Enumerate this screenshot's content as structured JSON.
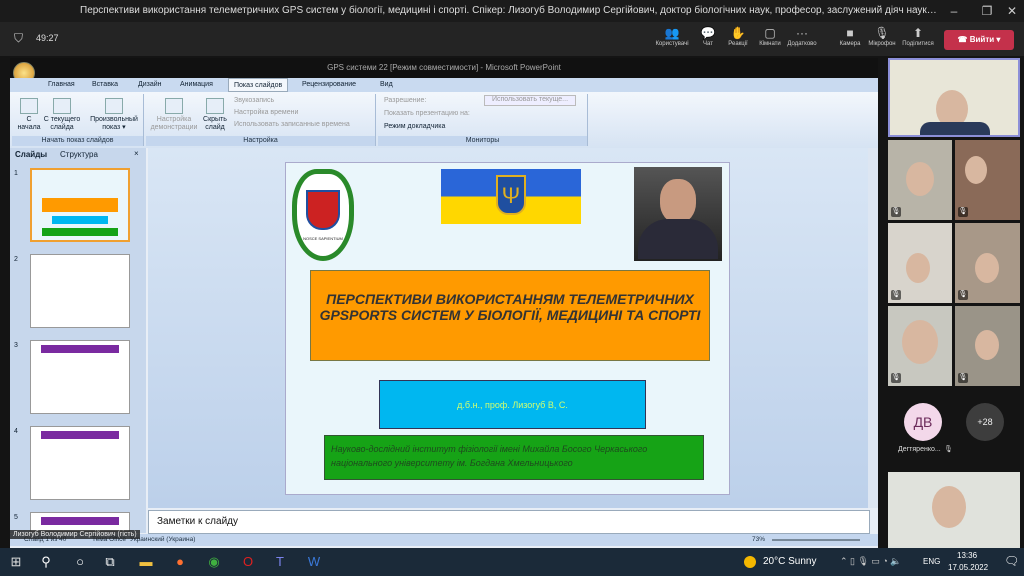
{
  "window": {
    "title": "Перспективи використання телеметричних GPS систем у біології, медицині і спорті. Спікер: Лизогуб Володимир Сергійович, доктор біологічних наук, професор, заслужений діяч науки і техніки, директор інституту біології ім. М. Босого ЧНУ ...",
    "minimize": "–",
    "maximize": "❐",
    "close": "✕"
  },
  "meeting": {
    "timer": "49:27",
    "toolbar": [
      {
        "label": "Користувачі",
        "icon": "people-icon",
        "glyph": "👥"
      },
      {
        "label": "Чат",
        "icon": "chat-icon",
        "glyph": "💬"
      },
      {
        "label": "Реакції",
        "icon": "reactions-icon",
        "glyph": "✋"
      },
      {
        "label": "Кімнати",
        "icon": "rooms-icon",
        "glyph": "▢"
      },
      {
        "label": "Додатково",
        "icon": "more-icon",
        "glyph": "···"
      },
      {
        "label": "Камера",
        "icon": "camera-icon",
        "glyph": "■"
      },
      {
        "label": "Мікрофон",
        "icon": "mic-off-icon",
        "glyph": "🎙"
      },
      {
        "label": "Поділитися",
        "icon": "share-icon",
        "glyph": "⬆"
      }
    ],
    "leave": "Вийти"
  },
  "ppt": {
    "title": "GPS системи 22 [Режим совместимости] - Microsoft PowerPoint",
    "tabs": [
      "Главная",
      "Вставка",
      "Дизайн",
      "Анимация",
      "Показ слайдов",
      "Рецензирование",
      "Вид"
    ],
    "ribbon": {
      "start_group": "Начать показ слайдов",
      "from_start": "С начала",
      "from_current": "С текущего слайда",
      "custom": "Произвольный показ ▾",
      "setup_group": "Настройка",
      "setup_show": "Настройка демонстрации",
      "hide_slide": "Скрыть слайд",
      "record": "Звукозапись",
      "timing": "Настройка времени",
      "use_timings": "Использовать записанные времена",
      "monitors_group": "Мониторы",
      "resolution": "Разрешение:",
      "resolution_value": "Использовать текуще...",
      "show_on": "Показать презентацию на:",
      "presenter": "Режим докладчика"
    },
    "panel_tabs": [
      "Слайды",
      "Структура"
    ],
    "slide_numbers": [
      "1",
      "2",
      "3",
      "4",
      "5"
    ],
    "slide": {
      "motto": "NOSCE SAPIENTIUM",
      "title": "ПЕРСПЕКТИВИ ВИКОРИСТАННЯМ ТЕЛЕМЕТРИЧНИХ GPSPORTS СИСТЕМ У БІОЛОГІЇ, МЕДИЦИНІ ТА СПОРТІ",
      "author": "д.б.н., проф. Лизогуб В, С.",
      "institute": "Науково-дослідний інститут фізіології імені Михайла Босого Черкаського національного університету ім. Богдана Хмельницького"
    },
    "notes": "Заметки к слайду",
    "status": {
      "slide": "Слайд 1 из 40",
      "theme": "Тема Office",
      "lang": "Украинский (Украина)",
      "zoom": "73%"
    },
    "presenter_tag": "Лизогуб Володимир Сергійович (гість)"
  },
  "participants": {
    "avatar_initials": "ДВ",
    "avatar_name": "Дегтяренко...",
    "more": "+28"
  },
  "taskbar": {
    "weather": "20°C  Sunny",
    "lang": "ENG",
    "time": "13:36",
    "date": "17.05.2022"
  }
}
